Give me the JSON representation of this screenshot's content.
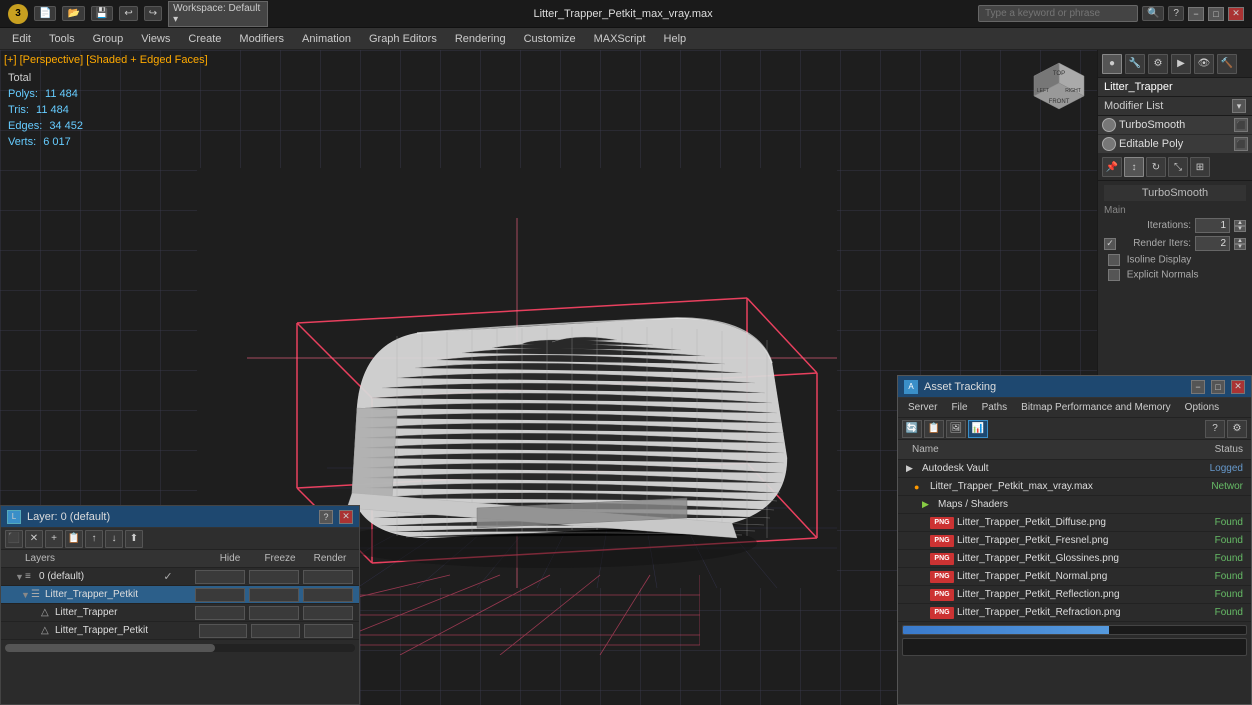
{
  "titlebar": {
    "logo": "3",
    "title": "Litter_Trapper_Petkit_max_vray.max",
    "search_placeholder": "Type a keyword or phrase",
    "minimize": "−",
    "maximize": "□",
    "close": "✕"
  },
  "menubar": {
    "items": [
      "Edit",
      "Tools",
      "Group",
      "Views",
      "Create",
      "Modifiers",
      "Animation",
      "Graph Editors",
      "Rendering",
      "Customize",
      "MAXScript",
      "Help"
    ]
  },
  "viewport": {
    "label": "[+] [Perspective] [Shaded + Edged Faces]",
    "stats": {
      "polys_label": "Polys:",
      "polys_val": "11 484",
      "tris_label": "Tris:",
      "tris_val": "11 484",
      "edges_label": "Edges:",
      "edges_val": "34 452",
      "verts_label": "Verts:",
      "verts_val": "6 017",
      "total_label": "Total"
    }
  },
  "right_panel": {
    "object_name": "Litter_Trapper",
    "modifier_list_label": "Modifier List",
    "modifiers": [
      {
        "name": "TurboSmooth",
        "bulb": true
      },
      {
        "name": "Editable Poly",
        "bulb": true
      }
    ],
    "turbosm": {
      "title": "TurboSmooth",
      "main_label": "Main",
      "iterations_label": "Iterations:",
      "iterations_val": "1",
      "render_iters_label": "Render Iters:",
      "render_iters_val": "2",
      "isoline_label": "Isoline Display",
      "explicit_normals_label": "Explicit Normals",
      "render_iters_checked": true,
      "isoline_checked": false,
      "explicit_normals_checked": false
    }
  },
  "layers_panel": {
    "title": "Layer: 0 (default)",
    "question_btn": "?",
    "close_btn": "✕",
    "toolbar_icons": [
      "⬛",
      "✕",
      "+",
      "📋",
      "⬆",
      "⬇",
      "⬆"
    ],
    "columns": {
      "layers": "Layers",
      "hide": "Hide",
      "freeze": "Freeze",
      "render": "Render"
    },
    "rows": [
      {
        "indent": 0,
        "expand": "▼",
        "name": "0 (default)",
        "check": "✓",
        "type": "layer",
        "selected": false
      },
      {
        "indent": 1,
        "expand": "",
        "name": "Litter_Trapper_Petkit",
        "check": "",
        "type": "object",
        "selected": true
      },
      {
        "indent": 2,
        "expand": "",
        "name": "Litter_Trapper",
        "check": "",
        "type": "mesh",
        "selected": false
      },
      {
        "indent": 2,
        "expand": "",
        "name": "Litter_Trapper_Petkit",
        "check": "",
        "type": "mesh",
        "selected": false
      }
    ]
  },
  "asset_tracking": {
    "title": "Asset Tracking",
    "min_btn": "−",
    "max_btn": "□",
    "close_btn": "✕",
    "menu_items": [
      "Server",
      "File",
      "Paths",
      "Bitmap Performance and Memory",
      "Options"
    ],
    "toolbar_icons": [
      "🔄",
      "📋",
      "🖼",
      "📊"
    ],
    "columns": {
      "name": "Name",
      "status": "Status"
    },
    "rows": [
      {
        "indent": 0,
        "name": "Autodesk Vault",
        "status": "Logged",
        "status_class": "status-logged",
        "type": "vault",
        "expand": true
      },
      {
        "indent": 1,
        "name": "Litter_Trapper_Petkit_max_vray.max",
        "status": "Networ",
        "status_class": "status-network",
        "type": "max",
        "expand": true
      },
      {
        "indent": 2,
        "name": "Maps / Shaders",
        "status": "",
        "type": "folder",
        "expand": true
      },
      {
        "indent": 3,
        "name": "Litter_Trapper_Petkit_Diffuse.png",
        "status": "Found",
        "status_class": "status-found",
        "type": "png"
      },
      {
        "indent": 3,
        "name": "Litter_Trapper_Petkit_Fresnel.png",
        "status": "Found",
        "status_class": "status-found",
        "type": "png"
      },
      {
        "indent": 3,
        "name": "Litter_Trapper_Petkit_Glossines.png",
        "status": "Found",
        "status_class": "status-found",
        "type": "png"
      },
      {
        "indent": 3,
        "name": "Litter_Trapper_Petkit_Normal.png",
        "status": "Found",
        "status_class": "status-found",
        "type": "png"
      },
      {
        "indent": 3,
        "name": "Litter_Trapper_Petkit_Reflection.png",
        "status": "Found",
        "status_class": "status-found",
        "type": "png"
      },
      {
        "indent": 3,
        "name": "Litter_Trapper_Petkit_Refraction.png",
        "status": "Found",
        "status_class": "status-found",
        "type": "png"
      }
    ]
  }
}
